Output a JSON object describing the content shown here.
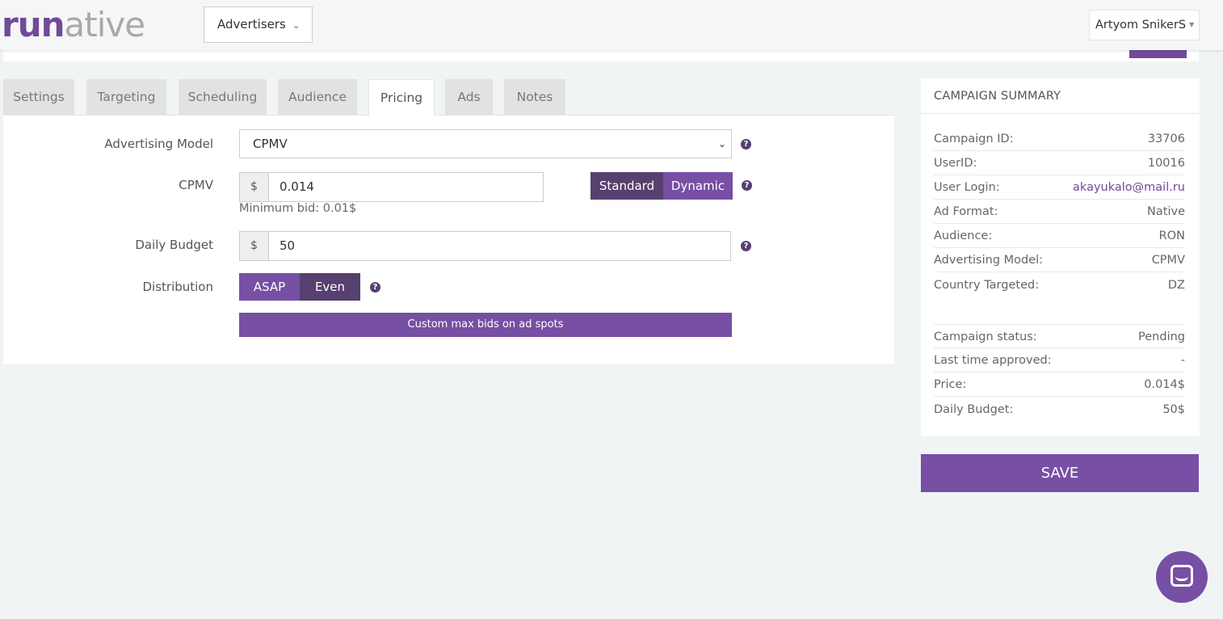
{
  "header": {
    "logo_run": "run",
    "logo_rest": "ative",
    "advertisers_label": "Advertisers",
    "user_name": "Artyom SnikerS"
  },
  "tabs": [
    {
      "label": "Settings",
      "active": false
    },
    {
      "label": "Targeting",
      "active": false
    },
    {
      "label": "Scheduling",
      "active": false
    },
    {
      "label": "Audience",
      "active": false
    },
    {
      "label": "Pricing",
      "active": true
    },
    {
      "label": "Ads",
      "active": false
    },
    {
      "label": "Notes",
      "active": false
    }
  ],
  "form": {
    "advertising_model_label": "Advertising Model",
    "advertising_model_value": "CPMV",
    "cpmv_label": "CPMV",
    "currency_symbol": "$",
    "cpmv_value": "0.014",
    "minimum_bid": "Minimum bid: 0.01$",
    "bid_mode_standard": "Standard",
    "bid_mode_dynamic": "Dynamic",
    "daily_budget_label": "Daily Budget",
    "daily_budget_value": "50",
    "distribution_label": "Distribution",
    "distribution_asap": "ASAP",
    "distribution_even": "Even",
    "custom_bids_button": "Custom max bids on ad spots",
    "help_glyph": "?"
  },
  "summary": {
    "title": "CAMPAIGN SUMMARY",
    "rows": [
      {
        "key": "Campaign ID:",
        "value": "33706"
      },
      {
        "key": "UserID:",
        "value": "10016"
      },
      {
        "key": "User Login:",
        "value": "akayukalo@mail.ru"
      },
      {
        "key": "Ad Format:",
        "value": "Native"
      },
      {
        "key": "Audience:",
        "value": "RON"
      },
      {
        "key": "Advertising Model:",
        "value": "CPMV"
      },
      {
        "key": "Country Targeted:",
        "value": "DZ"
      },
      {
        "key": "Campaign status:",
        "value": "Pending"
      },
      {
        "key": "Last time approved:",
        "value": "-"
      },
      {
        "key": "Price:",
        "value": "0.014$"
      },
      {
        "key": "Daily Budget:",
        "value": "50$"
      }
    ]
  },
  "save_label": "SAVE",
  "colors": {
    "brand_purple": "#774fa4",
    "dark_purple": "#56406f",
    "background": "#f1f4f5"
  }
}
